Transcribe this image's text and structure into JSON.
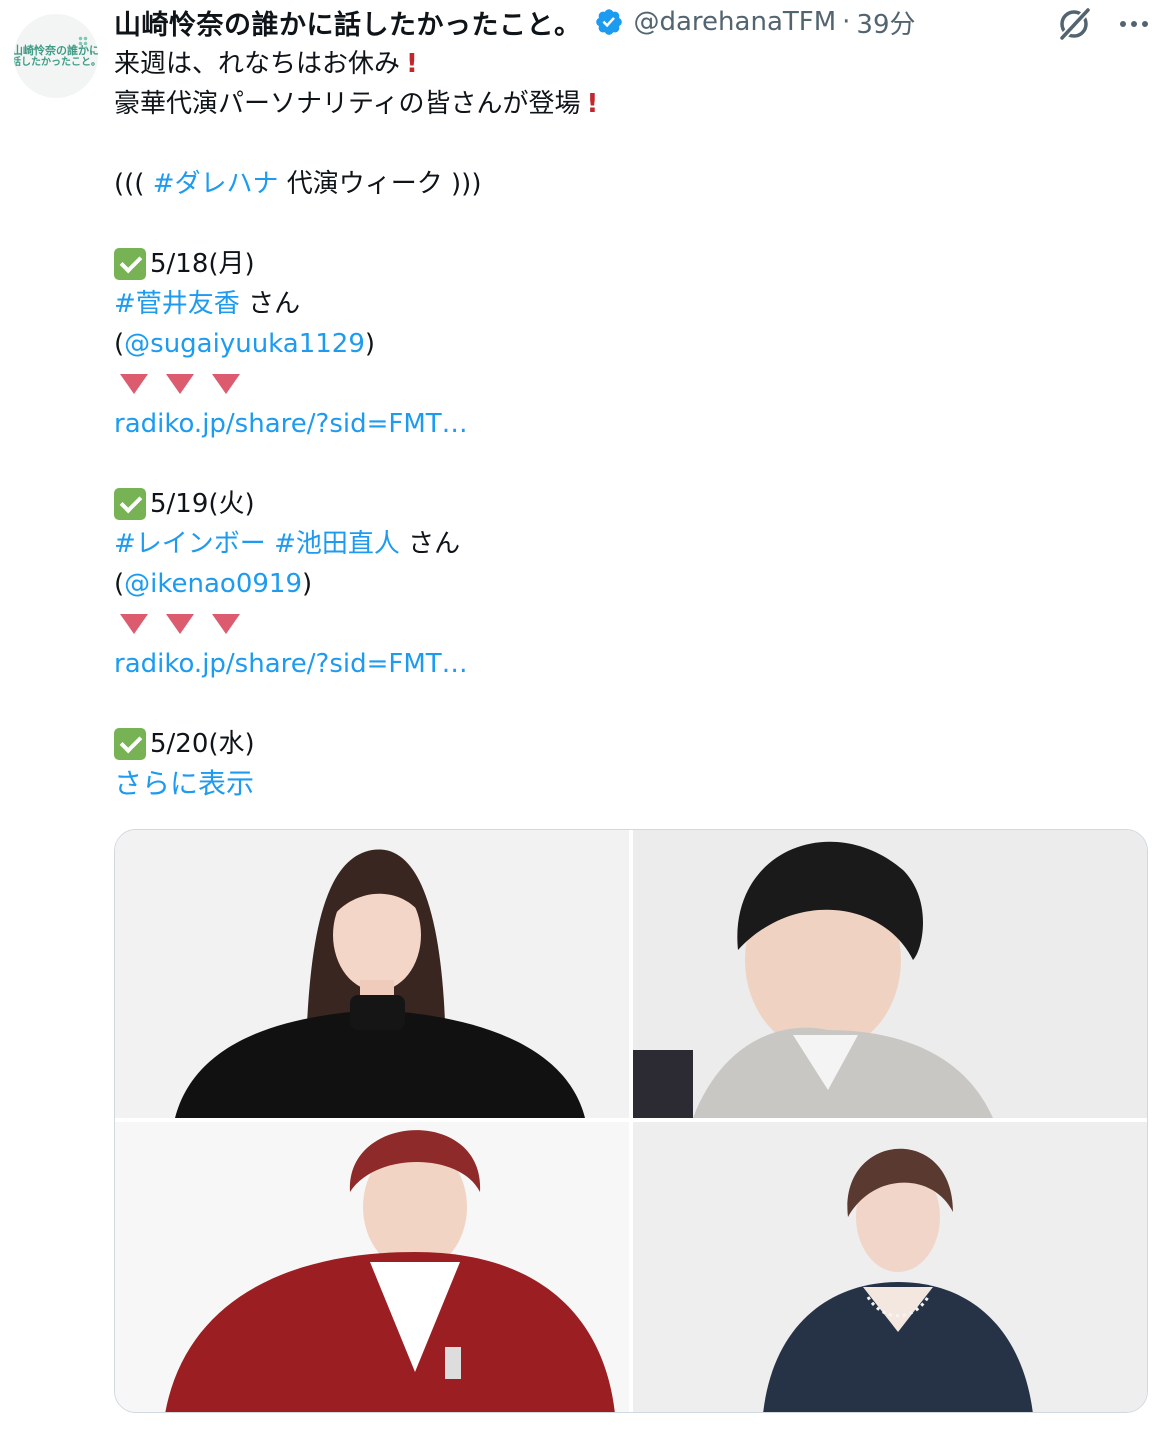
{
  "author": {
    "display_name": "山崎怜奈の誰かに話したかったこと。",
    "handle": "@darehanaTFM",
    "separator": "·",
    "time": "39分",
    "avatar_text": [
      "山崎怜奈の誰かに",
      "話したかったこと。"
    ]
  },
  "tweet": {
    "line1": "来週は、れなちはお休み",
    "line2": "豪華代演パーソナリティの皆さんが登場",
    "line3_prefix": "(((",
    "line3_hashtag": "#ダレハナ",
    "line3_suffix": "代演ウィーク )))",
    "day1_date": "5/18(月)",
    "day1_hashtag": "#菅井友香",
    "day1_san": "さん",
    "day1_paren_open": "(",
    "day1_mention": "@sugaiyuuka1129",
    "day1_paren_close": ")",
    "day1_link": "radiko.jp/share/?sid=FMT…",
    "day2_date": "5/19(火)",
    "day2_hashtag1": "#レインボー",
    "day2_hashtag2": "#池田直人",
    "day2_san": "さん",
    "day2_paren_open": "(",
    "day2_mention": "@ikenao0919",
    "day2_paren_close": ")",
    "day2_link": "radiko.jp/share/?sid=FMT…",
    "day3_date": "5/20(水)",
    "show_more": "さらに表示"
  },
  "colors": {
    "link": "#1d9bf0",
    "secondary_text": "#536471",
    "verified": "#1d9bf0",
    "check_emoji": "#77b255",
    "triangle_emoji": "#dd5b6e",
    "exclamation_emoji": "#c1272d"
  },
  "icons": [
    "verified-badge-icon",
    "grok-icon",
    "more-icon",
    "check-mark-icon",
    "down-triangle-icon",
    "exclamation-icon"
  ]
}
